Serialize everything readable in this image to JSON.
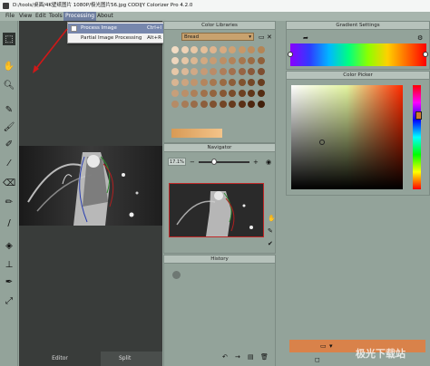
{
  "window": {
    "title": "D:/tools/桌面/4K壁纸图片 1080P/极光图片56.jpg CODIJY Colorizer Pro 4.2.0"
  },
  "menu": {
    "items": [
      "File",
      "View",
      "Edit",
      "Tools",
      "Processing",
      "About"
    ]
  },
  "processing_menu": {
    "items": [
      {
        "label": "Process Image",
        "shortcut": "Ctrl+I"
      },
      {
        "label": "Partial Image Processing",
        "shortcut": "Alt+R"
      }
    ]
  },
  "color_libraries": {
    "title": "Color Libraries",
    "library": "Bread"
  },
  "navigator": {
    "title": "Navigator",
    "zoom": "17.1%"
  },
  "history": {
    "title": "History"
  },
  "gradient_settings": {
    "title": "Gradient Settings"
  },
  "color_picker": {
    "title": "Color Picker"
  },
  "canvas_tabs": {
    "editor": "Editor",
    "split": "Split"
  },
  "watermark": {
    "text": "极光下载站"
  },
  "colors": {
    "swatches": [
      "#f2dcc4",
      "#efd2b5",
      "#e9c7a5",
      "#e5bf99",
      "#dfb48d",
      "#d8aa80",
      "#cfa173",
      "#c79767",
      "#bd8d5e",
      "#b38555",
      "#eed6bd",
      "#e6c6a6",
      "#dcb792",
      "#d2a981",
      "#c89b72",
      "#bd8e64",
      "#b38258",
      "#a7764d",
      "#9c6b43",
      "#90603a",
      "#e8c8a8",
      "#ddb998",
      "#d1a986",
      "#c69a76",
      "#bb8b67",
      "#af7d59",
      "#a3704d",
      "#976443",
      "#8a5839",
      "#7e4e30",
      "#d9b592",
      "#cda47f",
      "#c0946d",
      "#b4855d",
      "#a7774f",
      "#9a6a42",
      "#8d5d38",
      "#80522e",
      "#744726",
      "#683d1f",
      "#c79f7a",
      "#ba8f69",
      "#ad8059",
      "#a0714b",
      "#93643e",
      "#865733",
      "#794b29",
      "#6c4020",
      "#603619",
      "#542d13",
      "#b58b66",
      "#a77b57",
      "#996c49",
      "#8c5e3c",
      "#7f5130",
      "#724526",
      "#653a1d",
      "#593016",
      "#4d2710",
      "#41200b"
    ]
  }
}
